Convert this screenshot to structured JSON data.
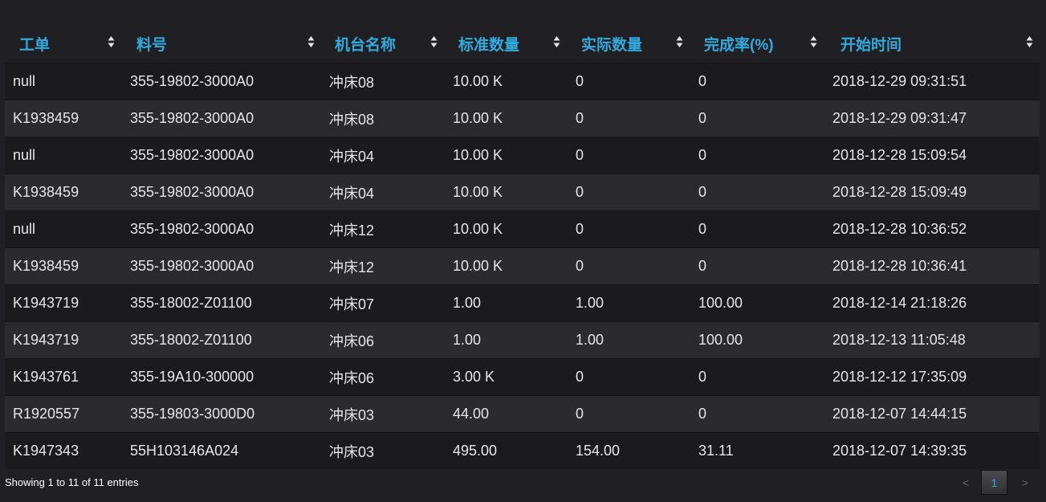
{
  "table": {
    "columns": [
      {
        "label": "工单"
      },
      {
        "label": "料号"
      },
      {
        "label": "机台名称"
      },
      {
        "label": "标准数量"
      },
      {
        "label": "实际数量"
      },
      {
        "label": "完成率(%)"
      },
      {
        "label": "开始时间"
      }
    ],
    "rows": [
      [
        "null",
        "355-19802-3000A0",
        "冲床08",
        "10.00 K",
        "0",
        "0",
        "2018-12-29 09:31:51"
      ],
      [
        "K1938459",
        "355-19802-3000A0",
        "冲床08",
        "10.00 K",
        "0",
        "0",
        "2018-12-29 09:31:47"
      ],
      [
        "null",
        "355-19802-3000A0",
        "冲床04",
        "10.00 K",
        "0",
        "0",
        "2018-12-28 15:09:54"
      ],
      [
        "K1938459",
        "355-19802-3000A0",
        "冲床04",
        "10.00 K",
        "0",
        "0",
        "2018-12-28 15:09:49"
      ],
      [
        "null",
        "355-19802-3000A0",
        "冲床12",
        "10.00 K",
        "0",
        "0",
        "2018-12-28 10:36:52"
      ],
      [
        "K1938459",
        "355-19802-3000A0",
        "冲床12",
        "10.00 K",
        "0",
        "0",
        "2018-12-28 10:36:41"
      ],
      [
        "K1943719",
        "355-18002-Z01100",
        "冲床07",
        "1.00",
        "1.00",
        "100.00",
        "2018-12-14 21:18:26"
      ],
      [
        "K1943719",
        "355-18002-Z01100",
        "冲床06",
        "1.00",
        "1.00",
        "100.00",
        "2018-12-13 11:05:48"
      ],
      [
        "K1943761",
        "355-19A10-300000",
        "冲床06",
        "3.00 K",
        "0",
        "0",
        "2018-12-12 17:35:09"
      ],
      [
        "R1920557",
        "355-19803-3000D0",
        "冲床03",
        "44.00",
        "0",
        "0",
        "2018-12-07 14:44:15"
      ],
      [
        "K1947343",
        "55H103146A024",
        "冲床03",
        "495.00",
        "154.00",
        "31.11",
        "2018-12-07 14:39:35"
      ]
    ]
  },
  "footer": {
    "info": "Showing 1 to 11 of 11 entries"
  },
  "pagination": {
    "prev": "<",
    "current_page": "1",
    "next": ">"
  },
  "colors": {
    "header_text": "#33aadd",
    "row_odd": "#1b1b1e",
    "row_even": "#2a2a2f",
    "background": "#1f1f24"
  }
}
